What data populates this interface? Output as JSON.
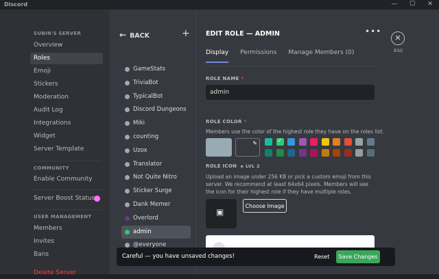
{
  "app": {
    "title": "Discord",
    "window_controls": [
      "—",
      "☐",
      "✕"
    ]
  },
  "sidebar": {
    "server_header": "SUBIN'S SERVER",
    "items": [
      "Overview",
      "Roles",
      "Emoji",
      "Stickers",
      "Moderation",
      "Audit Log",
      "Integrations",
      "Widget",
      "Server Template"
    ],
    "community_header": "COMMUNITY",
    "community_items": [
      "Enable Community"
    ],
    "boost_item": "Server Boost Status",
    "user_mgmt_header": "USER MANAGEMENT",
    "user_mgmt_items": [
      "Members",
      "Invites",
      "Bans"
    ],
    "delete_item": "Delete Server"
  },
  "roles_panel": {
    "back_label": "BACK",
    "roles": [
      {
        "name": "GameStats",
        "color": "#99aab5"
      },
      {
        "name": "TriviaBot",
        "color": "#99aab5"
      },
      {
        "name": "TypicalBot",
        "color": "#99aab5"
      },
      {
        "name": "Discord Dungeons",
        "color": "#99aab5"
      },
      {
        "name": "Miki",
        "color": "#99aab5"
      },
      {
        "name": "counting",
        "color": "#99aab5"
      },
      {
        "name": "Uzox",
        "color": "#99aab5"
      },
      {
        "name": "Translator",
        "color": "#99aab5"
      },
      {
        "name": "Not Quite Nitro",
        "color": "#99aab5"
      },
      {
        "name": "Sticker Surge",
        "color": "#99aab5"
      },
      {
        "name": "Dank Memer",
        "color": "#99aab5"
      },
      {
        "name": "Overlord",
        "color": "#71368a"
      },
      {
        "name": "admin",
        "color": "#2ecc71"
      },
      {
        "name": "@everyone",
        "color": "#99aab5"
      }
    ],
    "selected": "admin"
  },
  "editor": {
    "title": "EDIT ROLE — ADMIN",
    "tabs": [
      "Display",
      "Permissions",
      "Manage Members (0)"
    ],
    "role_name_label": "ROLE NAME",
    "role_name_value": "admin",
    "role_color_label": "ROLE COLOR",
    "role_color_desc": "Members use the color of the highest role they have on the roles list.",
    "palette_row1": [
      "#1abc9c",
      "#2ecc71",
      "#3498db",
      "#9b59b6",
      "#e91e63",
      "#f1c40f",
      "#e67e22",
      "#e74c3c",
      "#95a5a6",
      "#607d8b"
    ],
    "palette_row2": [
      "#11806a",
      "#1f8b4c",
      "#206694",
      "#71368a",
      "#ad1457",
      "#c27c0e",
      "#a84300",
      "#992d22",
      "#979c9f",
      "#546e7a"
    ],
    "selected_color": "#2ecc71",
    "role_icon_label": "ROLE ICON",
    "role_icon_level": "LVL 2",
    "role_icon_desc": "Upload an image under 256 KB or pick a custom emoji from this server. We recommend at least 64x64 pixels. Members will see the icon for their highest role if they have multiple roles.",
    "choose_image": "Choose Image"
  },
  "esc_label": "ESC",
  "notice": {
    "message": "Careful — you have unsaved changes!",
    "reset": "Reset",
    "save": "Save Changes"
  }
}
